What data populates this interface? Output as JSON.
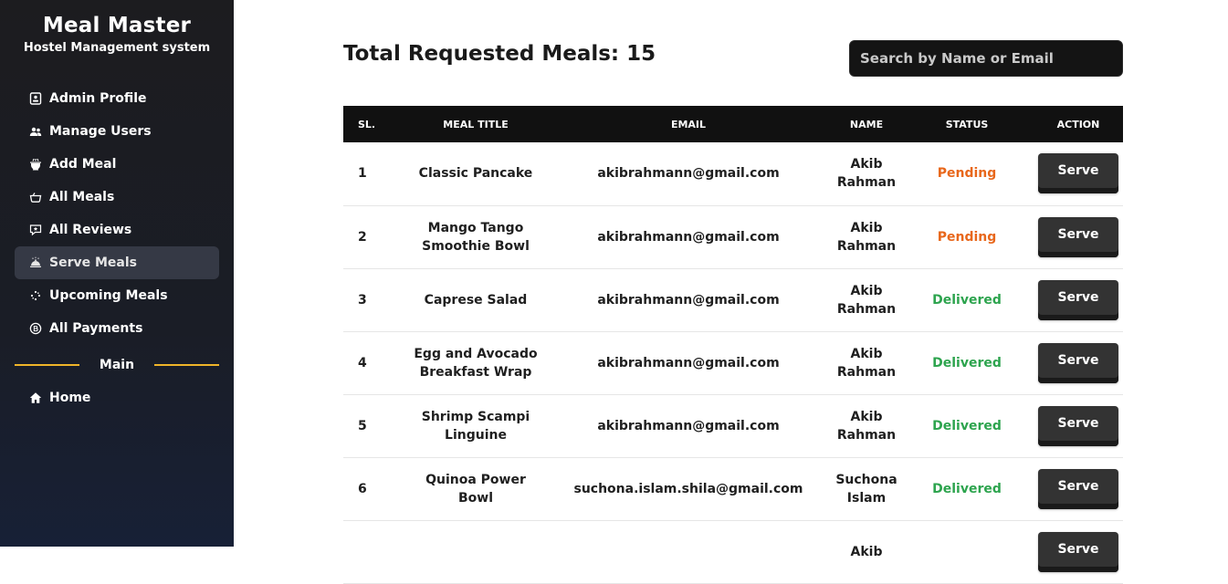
{
  "brand": {
    "title": "Meal Master",
    "subtitle": "Hostel Management system"
  },
  "sidebar": {
    "items": [
      {
        "label": "Admin Profile",
        "icon": "profile-icon",
        "active": false
      },
      {
        "label": "Manage Users",
        "icon": "users-icon",
        "active": false
      },
      {
        "label": "Add Meal",
        "icon": "add-meal-icon",
        "active": false
      },
      {
        "label": "All Meals",
        "icon": "bowl-icon",
        "active": false
      },
      {
        "label": "All Reviews",
        "icon": "review-icon",
        "active": false
      },
      {
        "label": "Serve Meals",
        "icon": "cloche-icon",
        "active": true
      },
      {
        "label": "Upcoming Meals",
        "icon": "sparkle-icon",
        "active": false
      },
      {
        "label": "All Payments",
        "icon": "payment-icon",
        "active": false
      }
    ],
    "divider_label": "Main",
    "home_label": "Home"
  },
  "header": {
    "title": "Total Requested Meals: 15",
    "search_placeholder": "Search by Name or Email"
  },
  "table": {
    "columns": [
      "SL.",
      "MEAL TITLE",
      "EMAIL",
      "NAME",
      "STATUS",
      "ACTION"
    ],
    "rows": [
      {
        "sl": "1",
        "meal": "Classic Pancake",
        "email": "akibrahmann@gmail.com",
        "name": "Akib Rahman",
        "status": "Pending",
        "action": "Serve"
      },
      {
        "sl": "2",
        "meal": "Mango Tango Smoothie Bowl",
        "email": "akibrahmann@gmail.com",
        "name": "Akib Rahman",
        "status": "Pending",
        "action": "Serve"
      },
      {
        "sl": "3",
        "meal": "Caprese Salad",
        "email": "akibrahmann@gmail.com",
        "name": "Akib Rahman",
        "status": "Delivered",
        "action": "Serve"
      },
      {
        "sl": "4",
        "meal": "Egg and Avocado Breakfast Wrap",
        "email": "akibrahmann@gmail.com",
        "name": "Akib Rahman",
        "status": "Delivered",
        "action": "Serve"
      },
      {
        "sl": "5",
        "meal": "Shrimp Scampi Linguine",
        "email": "akibrahmann@gmail.com",
        "name": "Akib Rahman",
        "status": "Delivered",
        "action": "Serve"
      },
      {
        "sl": "6",
        "meal": "Quinoa Power Bowl",
        "email": "suchona.islam.shila@gmail.com",
        "name": "Suchona Islam",
        "status": "Delivered",
        "action": "Serve"
      },
      {
        "sl": "",
        "meal": "",
        "email": "",
        "name": "Akib",
        "status": "",
        "action": "Serve"
      }
    ]
  },
  "colors": {
    "pending": "#e8671b",
    "delivered": "#2da44e",
    "accent_divider": "#f0b429",
    "button": "#333333"
  }
}
